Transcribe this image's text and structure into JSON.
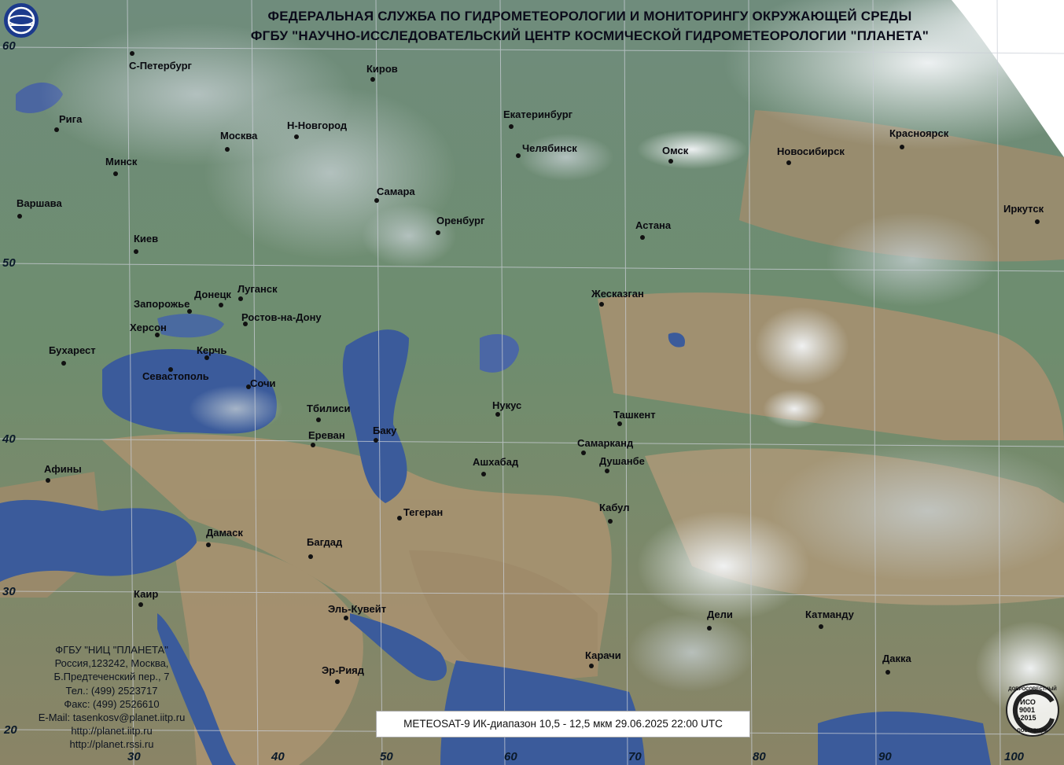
{
  "header": {
    "line1": "ФЕДЕРАЛЬНАЯ СЛУЖБА ПО ГИДРОМЕТЕОРОЛОГИИ И МОНИТОРИНГУ ОКРУЖАЮЩЕЙ СРЕДЫ",
    "line2": "ФГБУ \"НАУЧНО-ИССЛЕДОВАТЕЛЬСКИЙ ЦЕНТР КОСМИЧЕСКОЙ ГИДРОМЕТЕОРОЛОГИИ \"ПЛАНЕТА\""
  },
  "logo_icon": "roshydromet-globe-icon",
  "cities": {
    "spb": "С-Петербург",
    "kirov": "Киров",
    "riga": "Рига",
    "yekaterinburg": "Екатеринбург",
    "nnovgorod": "Н-Новгород",
    "moscow": "Москва",
    "chelyabinsk": "Челябинск",
    "krasnoyarsk": "Красноярск",
    "minsk": "Минск",
    "omsk": "Омск",
    "novosibirsk": "Новосибирск",
    "samara": "Самара",
    "warsaw": "Варшава",
    "irkutsk": "Иркутск",
    "orenburg": "Оренбург",
    "astana": "Астана",
    "kiev": "Киев",
    "lugansk": "Луганск",
    "donetsk": "Донецк",
    "zhezkazgan": "Жесказган",
    "zaporozhye": "Запорожье",
    "rostov": "Ростов-на-Дону",
    "kherson": "Херсон",
    "bucharest": "Бухарест",
    "kerch": "Керчь",
    "sevastopol": "Севастополь",
    "sochi": "Сочи",
    "nukus": "Нукус",
    "tbilisi": "Тбилиси",
    "tashkent": "Ташкент",
    "baku": "Баку",
    "yerevan": "Ереван",
    "samarkand": "Самарканд",
    "ashgabat": "Ашхабад",
    "dushanbe": "Душанбе",
    "athens": "Афины",
    "kabul": "Кабул",
    "tehran": "Тегеран",
    "damascus": "Дамаск",
    "baghdad": "Багдад",
    "cairo": "Каир",
    "delhi": "Дели",
    "kathmandu": "Катманду",
    "kuwait": "Эль-Кувейт",
    "karachi": "Карачи",
    "dhaka": "Дакка",
    "riyadh": "Эр-Рияд"
  },
  "latitudes": {
    "l60": "60",
    "l50": "50",
    "l40": "40",
    "l30": "30",
    "l20": "20"
  },
  "longitudes": {
    "g30": "30",
    "g40": "40",
    "g50": "50",
    "g60": "60",
    "g70": "70",
    "g80": "80",
    "g90": "90",
    "g100": "100"
  },
  "contact": {
    "org": "ФГБУ \"НИЦ \"ПЛАНЕТА\"",
    "address1": "Россия,123242, Москва,",
    "address2": "Б.Предтеченский пер., 7",
    "phone": "Тел.:  (499) 2523717",
    "fax": "Факс: (499) 2526610",
    "email": "E-Mail: tasenkosv@planet.iitp.ru",
    "url1": "http://planet.iitp.ru",
    "url2": "http://planet.rssi.ru"
  },
  "caption": "METEOSAT-9   ИК-диапазон 10,5 - 12,5 мкм   29.06.2025  22:00 UTC",
  "iso_badge": {
    "top_text": "ДОБРОСОВЕСТНЫЙ",
    "line1": "ИСО",
    "line2": "9001",
    "line3": "-2015",
    "bottom_text": "ПОСТАВЩИК"
  },
  "colors": {
    "sea": "#3a5a9a",
    "land_green": "#6e8c72",
    "desert": "#a58f6a",
    "cloud": "#e8eef2"
  }
}
